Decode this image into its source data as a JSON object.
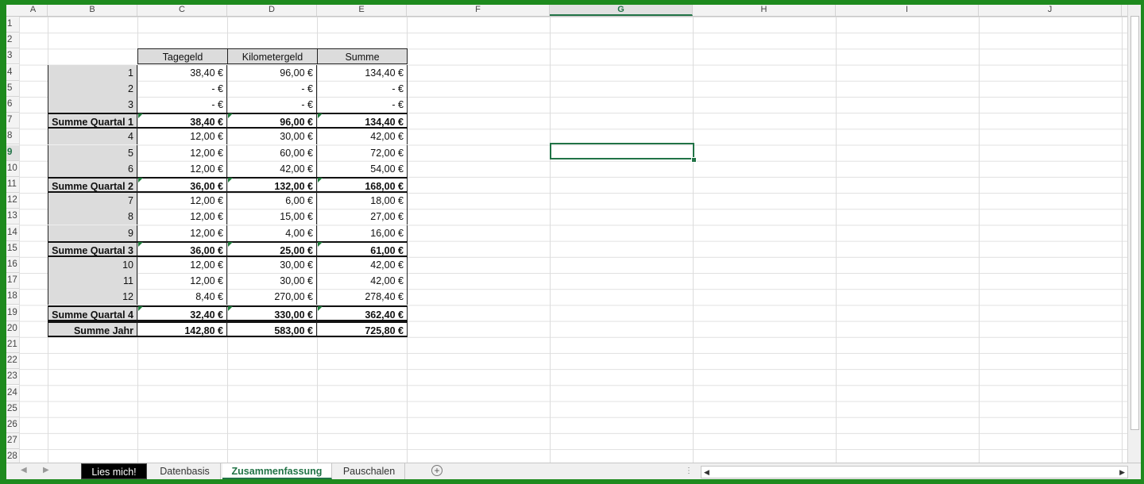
{
  "columns": [
    "A",
    "B",
    "C",
    "D",
    "E",
    "F",
    "G",
    "H",
    "I",
    "J"
  ],
  "selected_column": "G",
  "rows": [
    "1",
    "2",
    "3",
    "4",
    "5",
    "6",
    "7",
    "8",
    "9",
    "10",
    "11",
    "12",
    "13",
    "14",
    "15",
    "16",
    "17",
    "18",
    "19",
    "20",
    "21",
    "22",
    "23",
    "24",
    "25",
    "26",
    "27",
    "28"
  ],
  "selected_row": "9",
  "table": {
    "headers": [
      "Tagegeld",
      "Kilometergeld",
      "Summe"
    ],
    "rows": [
      {
        "label": "1",
        "tagegeld": "38,40 €",
        "km": "96,00 €",
        "summe": "134,40 €",
        "bold": false
      },
      {
        "label": "2",
        "tagegeld": "-    €",
        "km": "-    €",
        "summe": "-    €",
        "bold": false
      },
      {
        "label": "3",
        "tagegeld": "-    €",
        "km": "-    €",
        "summe": "-    €",
        "bold": false
      },
      {
        "label": "Summe Quartal 1",
        "tagegeld": "38,40 €",
        "km": "96,00 €",
        "summe": "134,40 €",
        "bold": true
      },
      {
        "label": "4",
        "tagegeld": "12,00 €",
        "km": "30,00 €",
        "summe": "42,00 €",
        "bold": false
      },
      {
        "label": "5",
        "tagegeld": "12,00 €",
        "km": "60,00 €",
        "summe": "72,00 €",
        "bold": false
      },
      {
        "label": "6",
        "tagegeld": "12,00 €",
        "km": "42,00 €",
        "summe": "54,00 €",
        "bold": false
      },
      {
        "label": "Summe Quartal 2",
        "tagegeld": "36,00 €",
        "km": "132,00 €",
        "summe": "168,00 €",
        "bold": true
      },
      {
        "label": "7",
        "tagegeld": "12,00 €",
        "km": "6,00 €",
        "summe": "18,00 €",
        "bold": false
      },
      {
        "label": "8",
        "tagegeld": "12,00 €",
        "km": "15,00 €",
        "summe": "27,00 €",
        "bold": false
      },
      {
        "label": "9",
        "tagegeld": "12,00 €",
        "km": "4,00 €",
        "summe": "16,00 €",
        "bold": false
      },
      {
        "label": "Summe Quartal 3",
        "tagegeld": "36,00 €",
        "km": "25,00 €",
        "summe": "61,00 €",
        "bold": true
      },
      {
        "label": "10",
        "tagegeld": "12,00 €",
        "km": "30,00 €",
        "summe": "42,00 €",
        "bold": false
      },
      {
        "label": "11",
        "tagegeld": "12,00 €",
        "km": "30,00 €",
        "summe": "42,00 €",
        "bold": false
      },
      {
        "label": "12",
        "tagegeld": "8,40 €",
        "km": "270,00 €",
        "summe": "278,40 €",
        "bold": false
      },
      {
        "label": "Summe Quartal 4",
        "tagegeld": "32,40 €",
        "km": "330,00 €",
        "summe": "362,40 €",
        "bold": true
      },
      {
        "label": "Summe Jahr",
        "tagegeld": "142,80 €",
        "km": "583,00 €",
        "summe": "725,80 €",
        "bold": true
      }
    ]
  },
  "sheet_tabs": [
    {
      "label": "Lies mich!",
      "style": "dark"
    },
    {
      "label": "Datenbasis",
      "style": "normal"
    },
    {
      "label": "Zusammenfassung",
      "style": "active"
    },
    {
      "label": "Pauschalen",
      "style": "normal"
    }
  ],
  "add_sheet_icon": "plus-circle-icon",
  "colors": {
    "accent": "#217346",
    "frame": "#1e8a1e",
    "header_gray": "#dcdcdc"
  }
}
